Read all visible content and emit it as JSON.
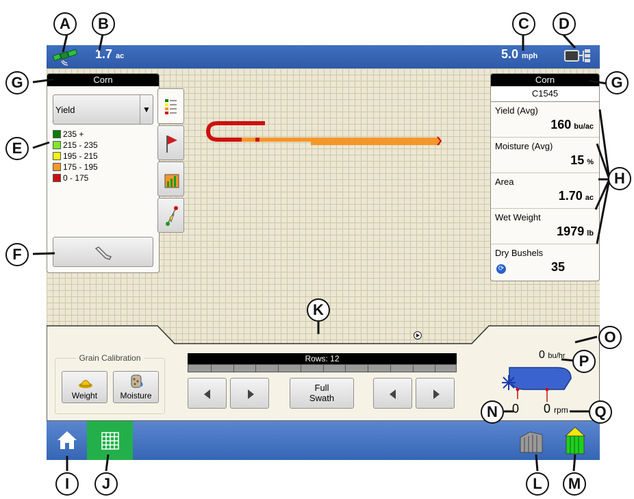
{
  "callouts": {
    "A": "A",
    "B": "B",
    "C": "C",
    "D": "D",
    "E": "E",
    "F": "F",
    "G": "G",
    "H": "H",
    "I": "I",
    "J": "J",
    "K": "K",
    "L": "L",
    "M": "M",
    "N": "N",
    "O": "O",
    "P": "P",
    "Q": "Q"
  },
  "topbar": {
    "area_value": "1.7",
    "area_unit": "ac",
    "speed_value": "5.0",
    "speed_unit": "mph"
  },
  "left_panel": {
    "header": "Corn",
    "dropdown_value": "Yield",
    "legend": [
      {
        "label": "235 +",
        "color": "#0a7d0a"
      },
      {
        "label": "215 - 235",
        "color": "#7ee82a"
      },
      {
        "label": "195 - 215",
        "color": "#f2f21a"
      },
      {
        "label": "175 - 195",
        "color": "#f5962a"
      },
      {
        "label": "0 - 175",
        "color": "#cc1010"
      }
    ]
  },
  "right_panel": {
    "header": "Corn",
    "subheader": "C1545",
    "stats": [
      {
        "label": "Yield (Avg)",
        "value": "160",
        "unit": "bu/ac"
      },
      {
        "label": "Moisture (Avg)",
        "value": "15",
        "unit": "%"
      },
      {
        "label": "Area",
        "value": "1.70",
        "unit": "ac"
      },
      {
        "label": "Wet Weight",
        "value": "1979",
        "unit": "lb"
      },
      {
        "label": "Dry Bushels",
        "value": "35",
        "unit": ""
      }
    ]
  },
  "grain_calibration": {
    "title": "Grain Calibration",
    "weight_label": "Weight",
    "moisture_label": "Moisture"
  },
  "rows": {
    "label": "Rows: 12"
  },
  "swath": {
    "full_swath_line1": "Full",
    "full_swath_line2": "Swath"
  },
  "combine": {
    "flow_value": "0",
    "flow_unit": "bu/hr",
    "fan_value": "0",
    "rpm_value": "0",
    "rpm_unit": "rpm"
  },
  "colors": {
    "topbar": "#2e5aa8",
    "nav": "#3566b5",
    "map_active": "#23b04a",
    "path_orange": "#f5962a",
    "path_red": "#cc1010",
    "bin_green": "#1fcf1f",
    "bin_yellow": "#f2e80a"
  },
  "icons": [
    "satellite-icon",
    "display-icon",
    "wrench-icon",
    "legend-icon",
    "flag-icon",
    "chart-icon",
    "guidance-icon",
    "home-icon",
    "map-grid-icon",
    "row-head-icon",
    "grain-bin-icon",
    "weight-icon",
    "moisture-icon",
    "combine-icon",
    "fan-icon",
    "gps-arrow-icon",
    "left-arrow-icon",
    "right-arrow-icon",
    "dry-bushels-icon"
  ]
}
